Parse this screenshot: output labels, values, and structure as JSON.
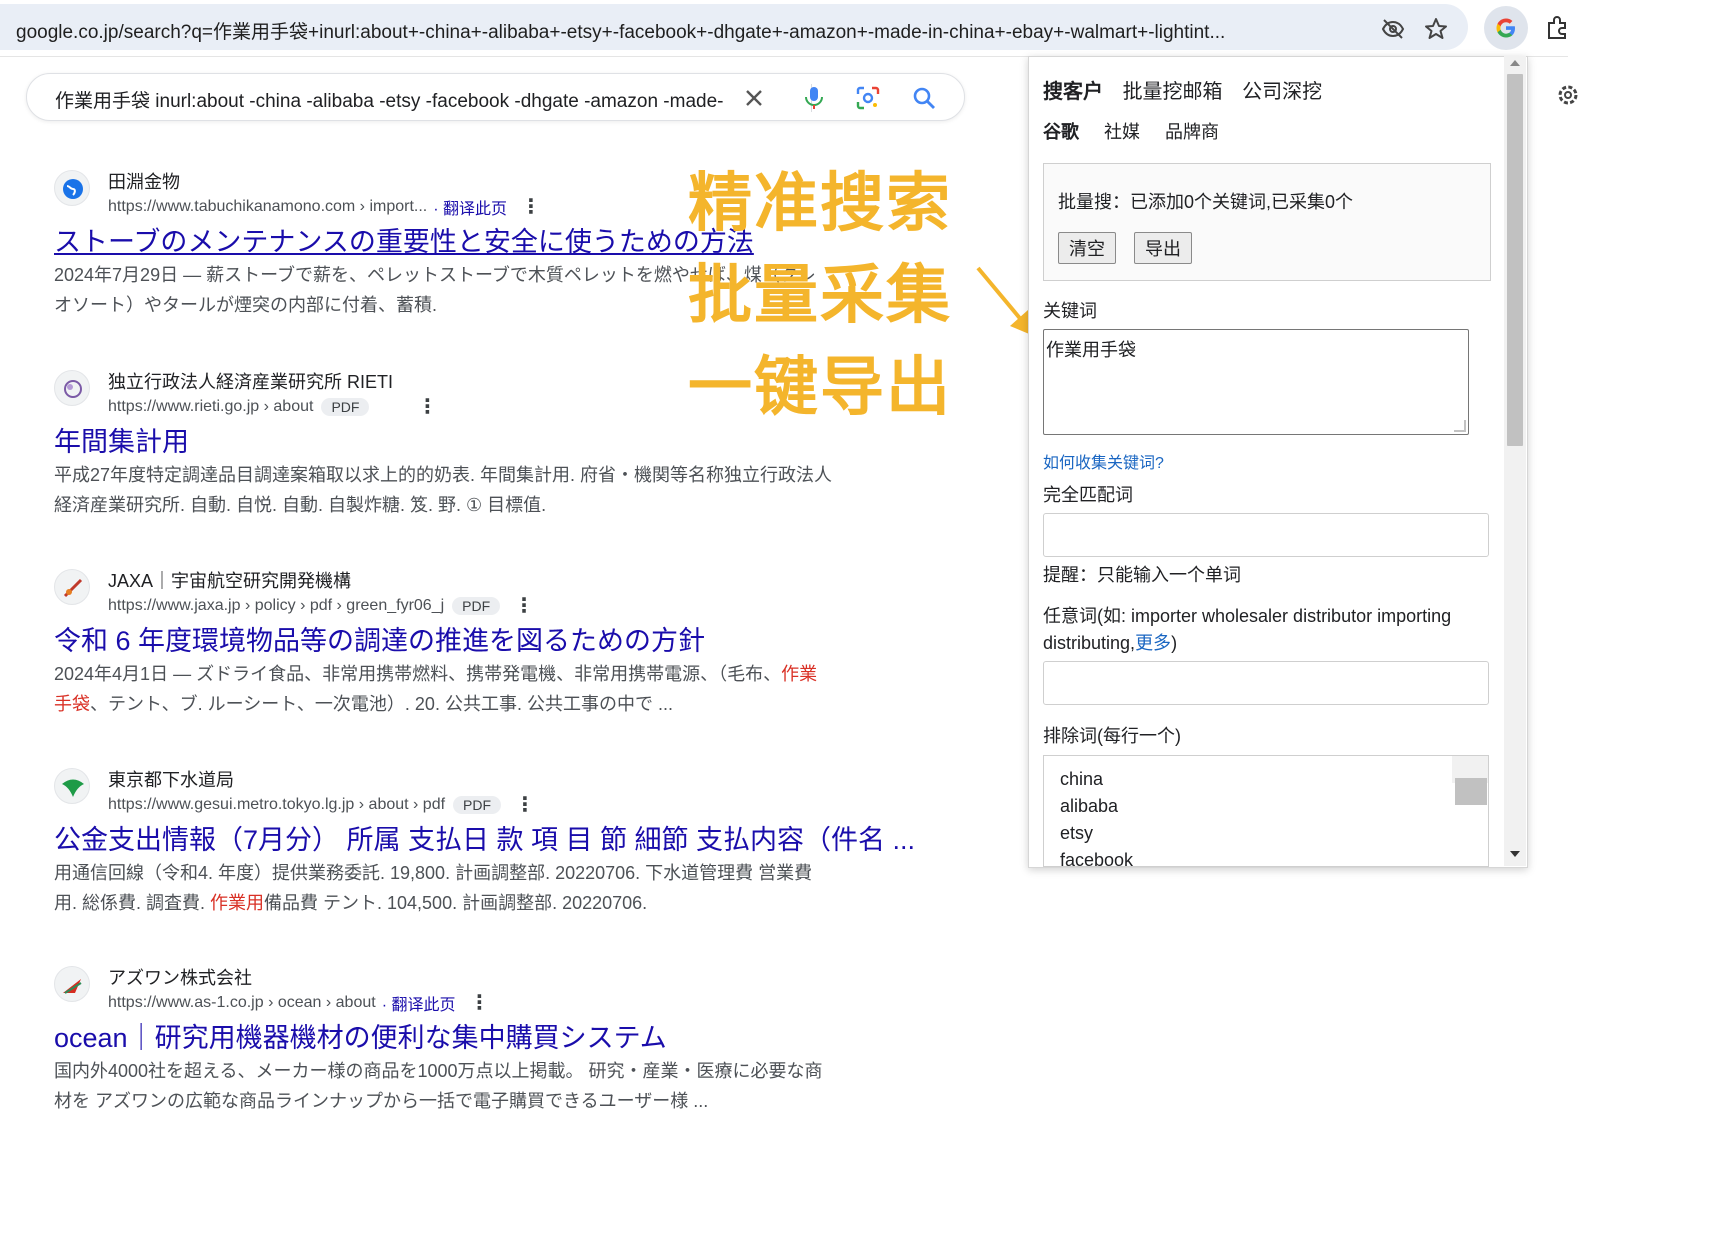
{
  "browser": {
    "url": "google.co.jp/search?q=作業用手袋+inurl:about+-china+-alibaba+-etsy+-facebook+-dhgate+-amazon+-made-in-china+-ebay+-walmart+-lightint..."
  },
  "search": {
    "query": "作業用手袋 inurl:about -china -alibaba -etsy -facebook -dhgate -amazon -made-"
  },
  "results": [
    {
      "site": "田淵金物",
      "url": "https://www.tabuchikanamono.com › import...",
      "translate": "· 翻译此页",
      "title": "ストーブのメンテナンスの重要性と安全に使うための方法",
      "snippet_1": "2024年7月29日 — 薪ストーブで薪を、ペレットストーブで木質ペレットを燃やせば、煤（クレ",
      "snippet_2": "オソート）やタールが煙突の内部に付着、蓄積."
    },
    {
      "site": "独立行政法人経済産業研究所 RIETI",
      "url": "https://www.rieti.go.jp › about",
      "badge": "PDF",
      "title": "年間集計用",
      "snippet_1": "平成27年度特定調達品目調達案箱取以求上的的奶表. 年間集計用. 府省・機関等名称独立行政法人",
      "snippet_2": "経済産業研究所. 自動. 自悦. 自動. 自製炸糖. 笈. 野. ① 目標值."
    },
    {
      "site": "JAXA｜宇宙航空研究開発機構",
      "url": "https://www.jaxa.jp › policy › pdf › green_fyr06_j",
      "badge": "PDF",
      "title": "令和 6 年度環境物品等の調達の推進を図るための方針",
      "snippet_1a": "2024年4月1日 — ズドライ食品、非常用携帯燃料、携帯発電機、非常用携帯電源、（毛布、",
      "snippet_1h": "作業",
      "snippet_2h": "手袋",
      "snippet_2b": "、テント、ブ. ルーシート、一次電池）. 20.  公共工事. 公共工事の中で ..."
    },
    {
      "site": "東京都下水道局",
      "url": "https://www.gesui.metro.tokyo.lg.jp › about › pdf",
      "badge": "PDF",
      "title": "公金支出情報（7月分） 所属 支払日 款 項 目 節 細節 支払内容（件名 ...",
      "snippet_1": "用通信回線（令和4. 年度）提供業務委託. 19,800. 計画調整部. 20220706. 下水道管理費 営業費",
      "snippet_2a": "用. 総係費. 調査費. ",
      "snippet_2h": "作業用",
      "snippet_2b": "備品費 テント. 104,500. 計画調整部. 20220706."
    },
    {
      "site": "アズワン株式会社",
      "url": "https://www.as-1.co.jp › ocean › about",
      "translate": "· 翻译此页",
      "title": "ocean｜研究用機器機材の便利な集中購買システム",
      "snippet_1": "国内外4000社を超える、メーカー様の商品を1000万点以上掲載。 研究・産業・医療に必要な商",
      "snippet_2": "材を アズワンの広範な商品ラインナップから一括で電子購買できるユーザー様 ..."
    }
  ],
  "promo": {
    "line1": "精准搜索",
    "line2": "批量采集",
    "line3": "一键导出",
    "color": "#f4b52c"
  },
  "panel": {
    "tabs": [
      "搜客户",
      "批量挖邮箱",
      "公司深挖"
    ],
    "subtabs": [
      "谷歌",
      "社媒",
      "品牌商"
    ],
    "batch_status": "批量搜：已添加0个关键词,已采集0个",
    "clear_label": "清空",
    "export_label": "导出",
    "keyword_label": "关键词",
    "keyword_value": "作業用手袋",
    "how_link": "如何收集关键词?",
    "exact_label": "完全匹配词",
    "exact_hint": "提醒：只能输入一个单词",
    "any_label_1": "任意词(如: importer wholesaler distributor importing",
    "any_label_2": "distributing,",
    "any_more": "更多",
    "any_close": ")",
    "exclude_label": "排除词(每行一个)",
    "exclude_words": [
      "china",
      "alibaba",
      "etsy",
      "facebook"
    ]
  }
}
